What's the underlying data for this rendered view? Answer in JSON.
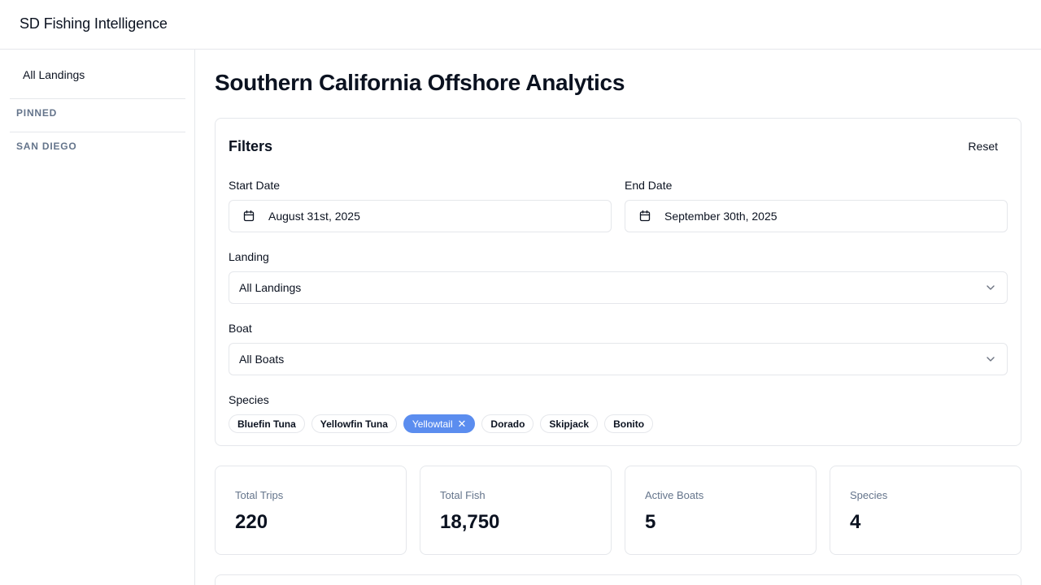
{
  "header": {
    "brand": "SD Fishing Intelligence"
  },
  "sidebar": {
    "link": "All Landings",
    "sections": [
      "PINNED",
      "SAN DIEGO"
    ]
  },
  "page": {
    "title": "Southern California Offshore Analytics"
  },
  "filters": {
    "title": "Filters",
    "reset_label": "Reset",
    "start_date": {
      "label": "Start Date",
      "value": "August 31st, 2025"
    },
    "end_date": {
      "label": "End Date",
      "value": "September 30th, 2025"
    },
    "landing": {
      "label": "Landing",
      "value": "All Landings"
    },
    "boat": {
      "label": "Boat",
      "value": "All Boats"
    },
    "species": {
      "label": "Species",
      "options": [
        "Bluefin Tuna",
        "Yellowfin Tuna",
        "Yellowtail",
        "Dorado",
        "Skipjack",
        "Bonito"
      ],
      "selected": "Yellowtail",
      "remove_glyph": "✕"
    }
  },
  "stats": [
    {
      "label": "Total Trips",
      "value": "220"
    },
    {
      "label": "Total Fish",
      "value": "18,750"
    },
    {
      "label": "Active Boats",
      "value": "5"
    },
    {
      "label": "Species",
      "value": "4"
    }
  ],
  "colors": {
    "accent": "#5b8def",
    "border": "#e5e7eb",
    "muted": "#64748b",
    "text": "#0b1220"
  },
  "icons": {
    "date": "calendar-icon",
    "select": "chevron-down-icon",
    "chip_remove": "close-icon"
  }
}
